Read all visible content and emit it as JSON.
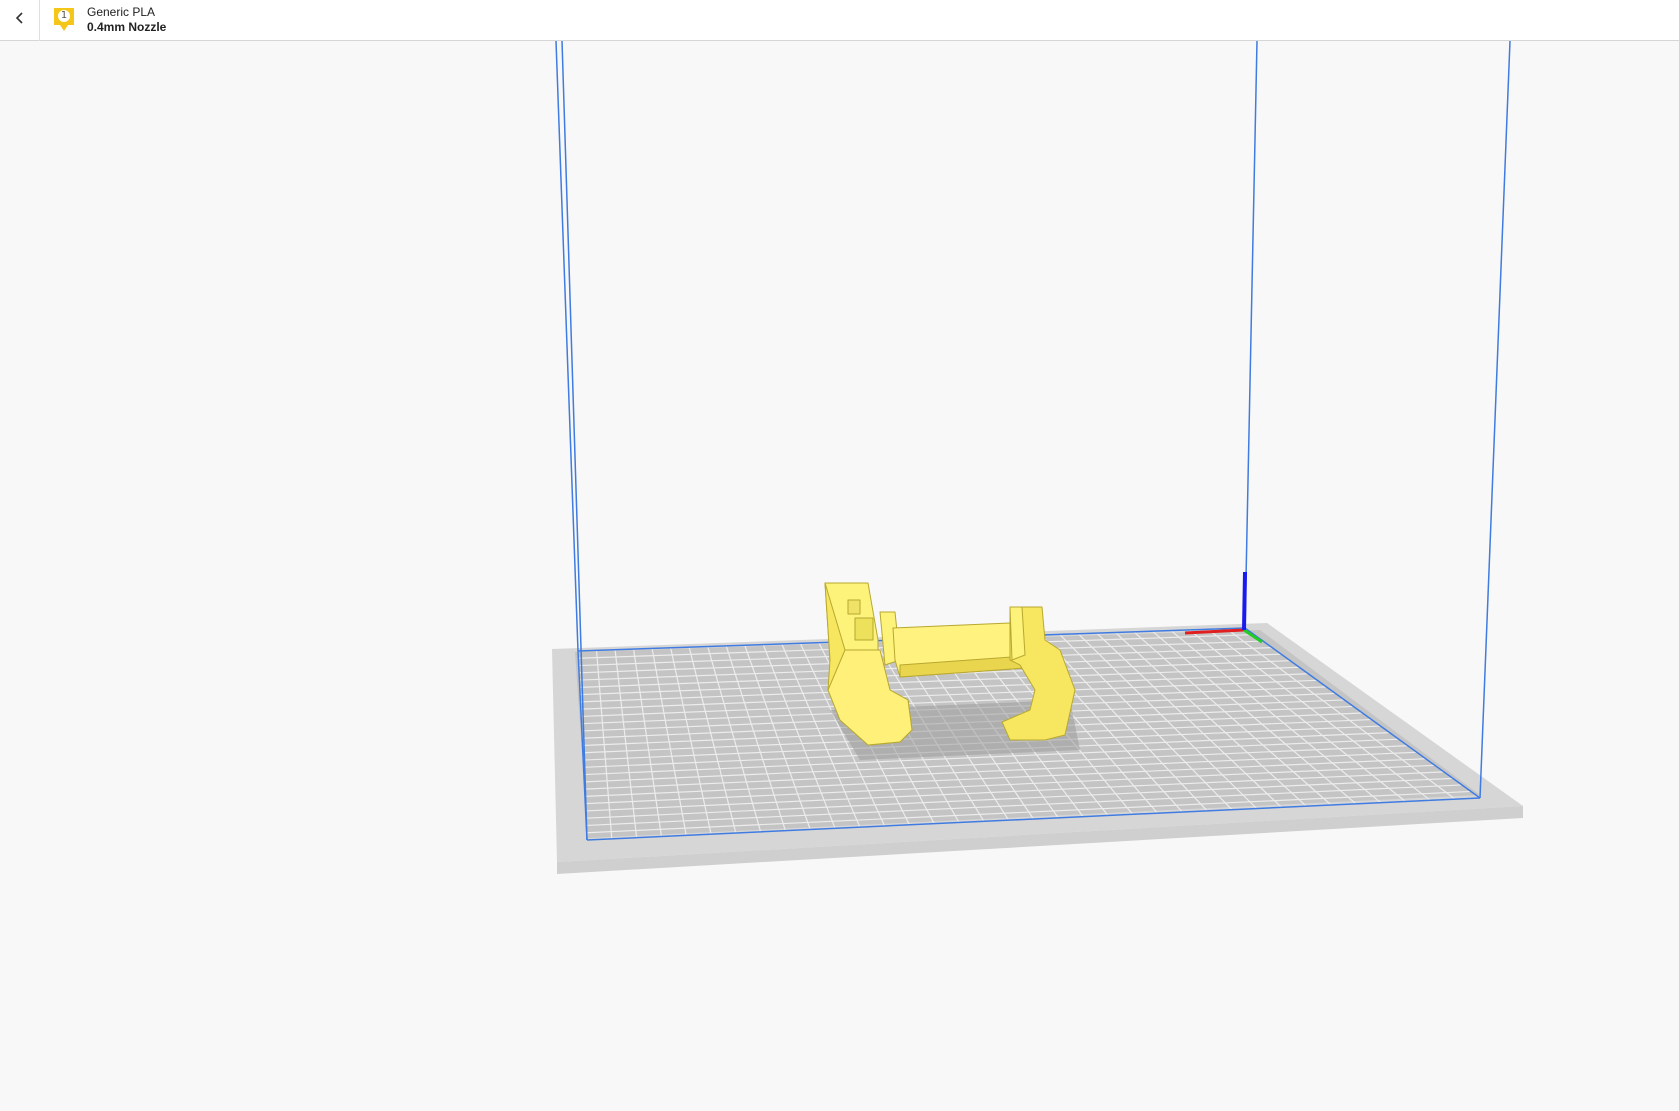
{
  "header": {
    "back_label": "back",
    "extruder": {
      "number": "1",
      "material": "Generic PLA",
      "nozzle": "0.4mm Nozzle",
      "color": "#f5c518"
    }
  },
  "scene": {
    "model_color": "#fdf27a",
    "build_volume_color": "#3f7be0",
    "plate_color": "#d9d9d9",
    "axis_colors": {
      "x": "#e02020",
      "y": "#22cc22",
      "z": "#1a1aee"
    }
  }
}
